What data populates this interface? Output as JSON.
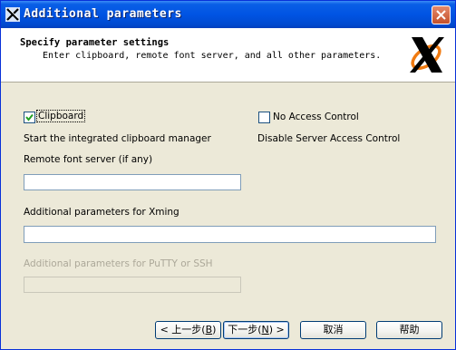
{
  "window": {
    "title": "Additional parameters"
  },
  "header": {
    "title": "Specify parameter settings",
    "subtitle": "Enter clipboard, remote font server, and all other parameters."
  },
  "options": {
    "clipboard": {
      "label": "Clipboard",
      "checked": true,
      "description": "Start the integrated clipboard manager"
    },
    "no_access_control": {
      "label": "No Access Control",
      "checked": false,
      "description": "Disable Server Access Control"
    }
  },
  "fields": {
    "remote_font_server": {
      "label": "Remote font server (if any)",
      "value": ""
    },
    "xming_params": {
      "label": "Additional parameters for Xming",
      "value": ""
    },
    "putty_params": {
      "label": "Additional parameters for PuTTY or SSH",
      "value": "",
      "disabled": true
    }
  },
  "buttons": {
    "back": {
      "prefix": "< 上一步(",
      "key": "B",
      "suffix": ")"
    },
    "next": {
      "prefix": "下一步(",
      "key": "N",
      "suffix": ") >"
    },
    "cancel": "取消",
    "help": "帮助"
  }
}
